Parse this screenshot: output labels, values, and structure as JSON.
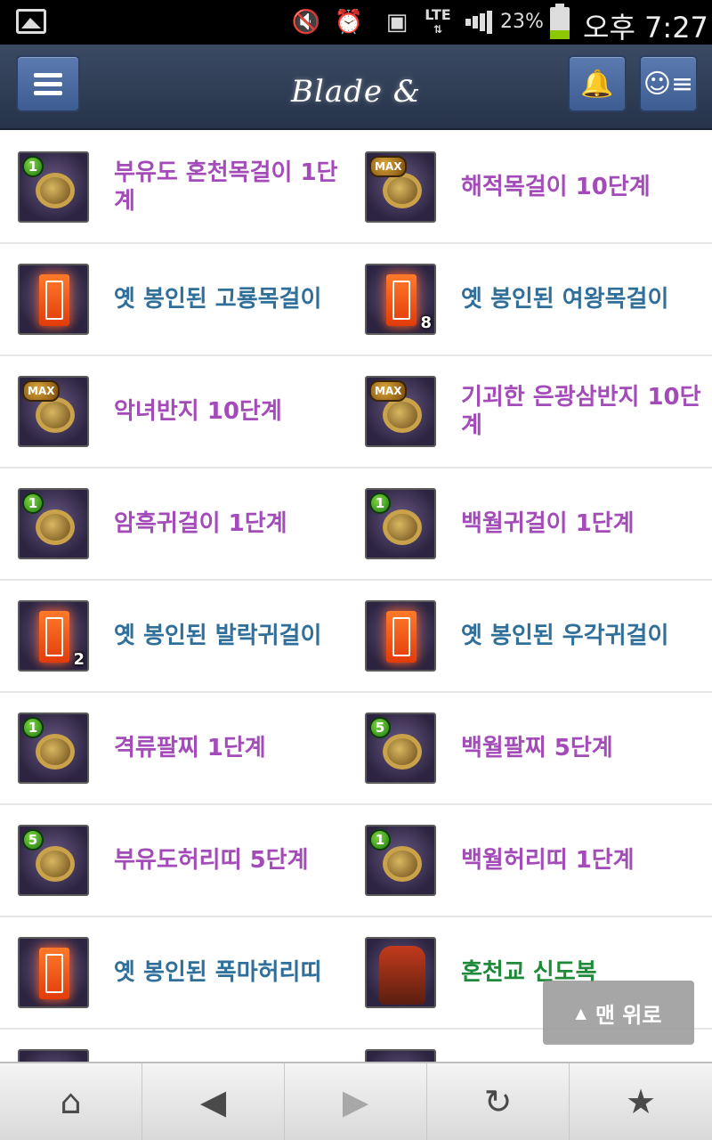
{
  "status_bar": {
    "network": "LTE",
    "battery": "23%",
    "time": "오후 7:27"
  },
  "header": {
    "logo": "Blade & Soul"
  },
  "items": [
    [
      {
        "label": "부유도 혼천목걸이 1단계",
        "color": "purple",
        "badge": "1",
        "thumb": "jewel"
      },
      {
        "label": "해적목걸이 10단계",
        "color": "purple",
        "badge": "MAX",
        "thumb": "jewel"
      }
    ],
    [
      {
        "label": "옛 봉인된 고룡목걸이",
        "color": "blue",
        "badge": "",
        "count": "",
        "thumb": "sealed"
      },
      {
        "label": "옛 봉인된 여왕목걸이",
        "color": "blue",
        "badge": "",
        "count": "8",
        "thumb": "sealed"
      }
    ],
    [
      {
        "label": "악녀반지 10단계",
        "color": "purple",
        "badge": "MAX",
        "thumb": "jewel"
      },
      {
        "label": "기괴한 은광삼반지 10단계",
        "color": "purple",
        "badge": "MAX",
        "thumb": "jewel"
      }
    ],
    [
      {
        "label": "암흑귀걸이 1단계",
        "color": "purple",
        "badge": "1",
        "thumb": "jewel"
      },
      {
        "label": "백월귀걸이 1단계",
        "color": "purple",
        "badge": "1",
        "thumb": "jewel"
      }
    ],
    [
      {
        "label": "옛 봉인된 발락귀걸이",
        "color": "blue",
        "badge": "",
        "count": "2",
        "thumb": "sealed"
      },
      {
        "label": "옛 봉인된 우각귀걸이",
        "color": "blue",
        "badge": "",
        "count": "",
        "thumb": "sealed"
      }
    ],
    [
      {
        "label": "격류팔찌 1단계",
        "color": "purple",
        "badge": "1",
        "thumb": "jewel"
      },
      {
        "label": "백월팔찌 5단계",
        "color": "purple",
        "badge": "5",
        "thumb": "jewel"
      }
    ],
    [
      {
        "label": "부유도허리띠 5단계",
        "color": "purple",
        "badge": "5",
        "thumb": "jewel"
      },
      {
        "label": "백월허리띠 1단계",
        "color": "purple",
        "badge": "1",
        "thumb": "jewel"
      }
    ],
    [
      {
        "label": "옛 봉인된 폭마허리띠",
        "color": "blue",
        "badge": "",
        "count": "",
        "thumb": "sealed"
      },
      {
        "label": "혼천교 신도복",
        "color": "green",
        "badge": "",
        "count": "",
        "thumb": "robe"
      }
    ]
  ],
  "back_to_top": "맨 위로",
  "toolbar": {
    "icons": [
      "home-icon",
      "back-arrow-icon",
      "forward-arrow-icon",
      "refresh-icon",
      "star-icon"
    ]
  }
}
